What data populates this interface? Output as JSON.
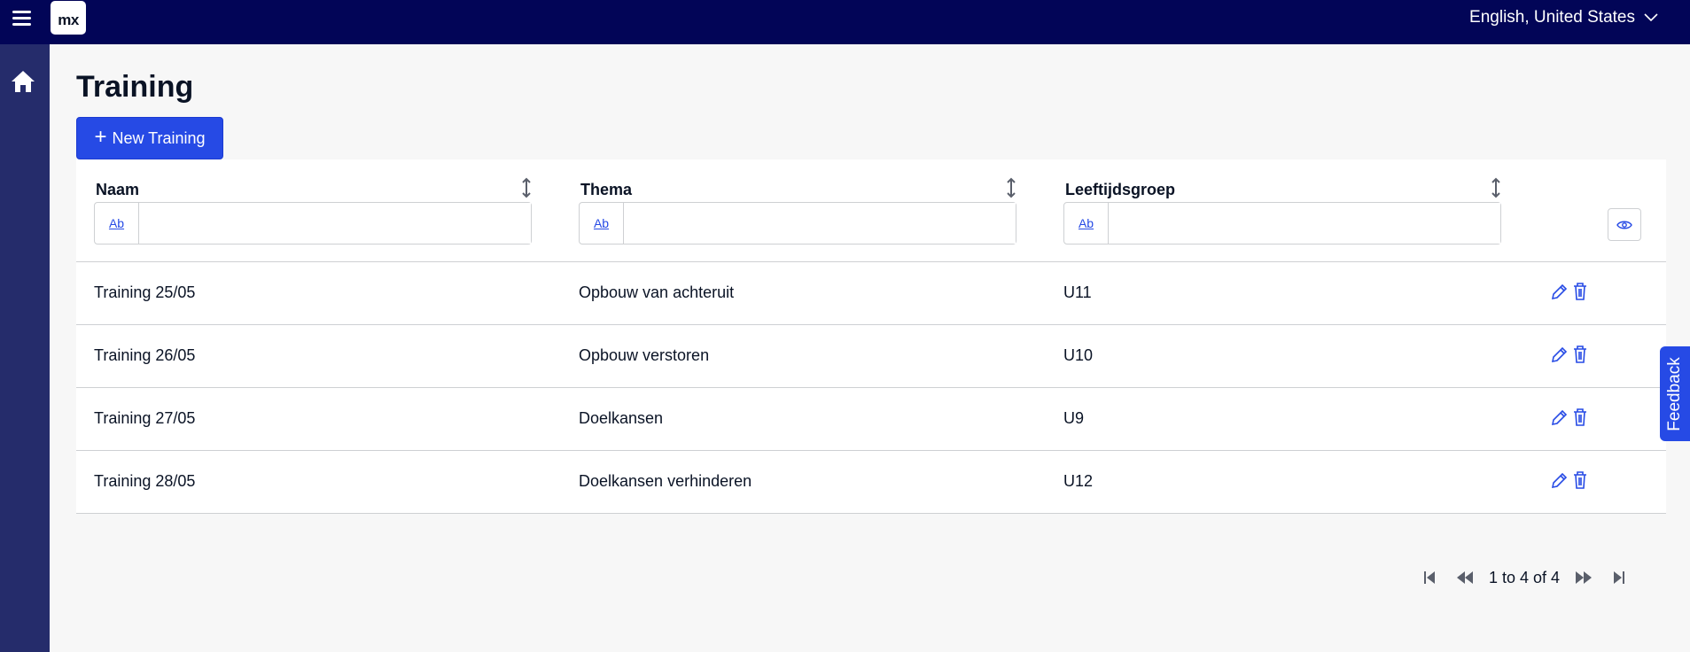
{
  "header": {
    "logo_text": "mx",
    "language": "English, United States"
  },
  "page": {
    "title": "Training",
    "new_button_label": "New Training"
  },
  "grid": {
    "columns": [
      {
        "label": "Naam",
        "filter_type": "Ab"
      },
      {
        "label": "Thema",
        "filter_type": "Ab"
      },
      {
        "label": "Leeftijdsgroep",
        "filter_type": "Ab"
      }
    ],
    "rows": [
      {
        "naam": "Training 25/05",
        "thema": "Opbouw van achteruit",
        "leeftijdsgroep": "U11"
      },
      {
        "naam": "Training 26/05",
        "thema": "Opbouw verstoren",
        "leeftijdsgroep": "U10"
      },
      {
        "naam": "Training 27/05",
        "thema": "Doelkansen",
        "leeftijdsgroep": "U9"
      },
      {
        "naam": "Training 28/05",
        "thema": "Doelkansen verhinderen",
        "leeftijdsgroep": "U12"
      }
    ]
  },
  "pagination": {
    "text": "1 to 4 of 4"
  },
  "feedback_label": "Feedback",
  "colors": {
    "topbar": "#020557",
    "sidebar": "#252c6b",
    "primary": "#264ae5"
  },
  "icons": [
    "menu-icon",
    "home-icon",
    "chevron-down-icon",
    "plus-icon",
    "sort-icon",
    "eye-icon",
    "edit-icon",
    "trash-icon",
    "first-page-icon",
    "previous-page-icon",
    "next-page-icon",
    "last-page-icon"
  ]
}
